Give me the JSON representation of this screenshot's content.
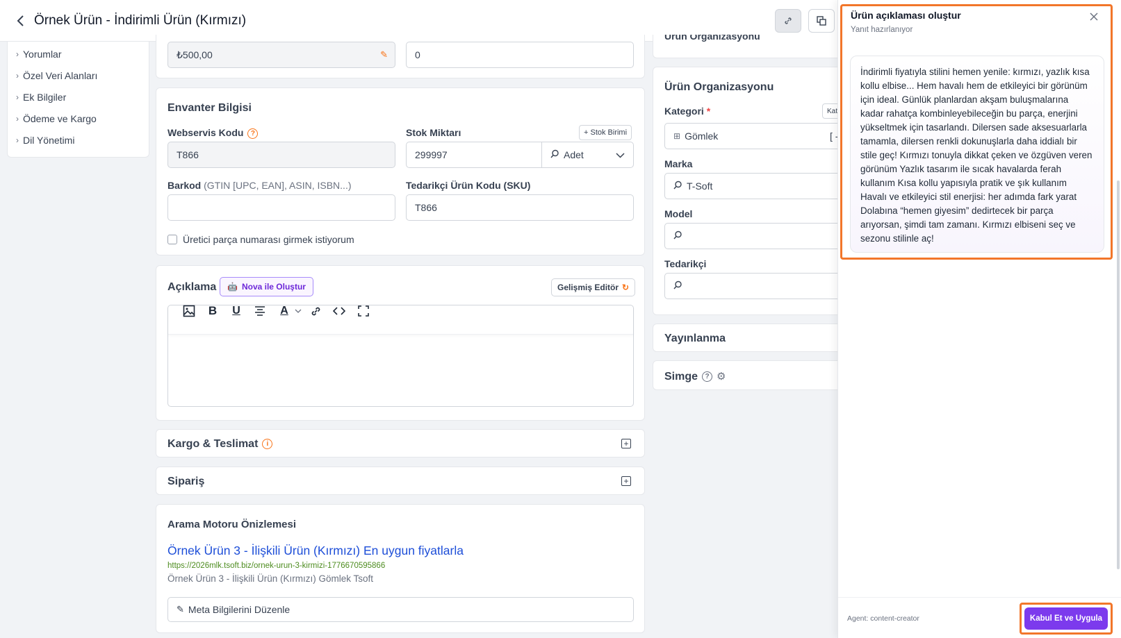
{
  "header": {
    "title": "Örnek Ürün - İndirimli Ürün (Kırmızı)"
  },
  "sidebar": {
    "items": [
      {
        "label": "Yorumlar"
      },
      {
        "label": "Özel Veri Alanları"
      },
      {
        "label": "Ek Bilgiler"
      },
      {
        "label": "Ödeme ve Kargo"
      },
      {
        "label": "Dil Yönetimi"
      }
    ]
  },
  "pricing": {
    "price_value": "₺500,00",
    "second_value": "0"
  },
  "inventory": {
    "title": "Envanter Bilgisi",
    "webservice_label": "Webservis Kodu",
    "webservice_value": "T866",
    "stock_label": "Stok Miktarı",
    "stock_unit_button": "+ Stok Birimi",
    "stock_value": "299997",
    "stock_unit": "Adet",
    "barcode_label": "Barkod",
    "barcode_hint": "(GTIN [UPC, EAN], ASIN, ISBN...)",
    "barcode_value": "",
    "sku_label": "Tedarikçi Ürün Kodu (SKU)",
    "sku_value": "T866",
    "mpn_checkbox": "Üretici parça numarası girmek istiyorum"
  },
  "description": {
    "title": "Açıklama",
    "nova_button": "Nova ile Oluştur",
    "advanced_editor": "Gelişmiş Editör"
  },
  "shipping": {
    "title": "Kargo & Teslimat"
  },
  "order": {
    "title": "Sipariş"
  },
  "seo": {
    "title": "Arama Motoru Önizlemesi",
    "link_title": "Örnek Ürün 3 - İlişkili Ürün (Kırmızı) En uygun fiyatlarla",
    "url": "https://2026mlk.tsoft.biz/ornek-urun-3-kirmizi-1776670595866",
    "description": "Örnek Ürün 3 - İlişkili Ürün (Kırmızı) Gömlek Tsoft",
    "edit_meta": "Meta Bilgilerini Düzenle"
  },
  "organization": {
    "partial_title": "Ürün Organizasyonu",
    "title": "Ürün Organizasyonu",
    "category_label": "Kategori",
    "category_badge": "Kate",
    "category_value": "Gömlek",
    "category_suffix": "[ -",
    "brand_label": "Marka",
    "brand_value": "T-Soft",
    "model_label": "Model",
    "supplier_label": "Tedarikçi"
  },
  "publish": {
    "title": "Yayınlanma"
  },
  "icon_section": {
    "title": "Simge"
  },
  "panel": {
    "title": "Ürün açıklaması oluştur",
    "subtitle": "Yanıt hazırlanıyor",
    "message": "İndirimli fiyatıyla stilini hemen yenile: kırmızı, yazlık kısa kollu elbise... Hem havalı hem de etkileyici bir görünüm için ideal. Günlük planlardan akşam buluşmalarına kadar rahatça kombinleyebileceğin bu parça, enerjini yükseltmek için tasarlandı. Dilersen sade aksesuarlarla tamamla, dilersen renkli dokunuşlarla daha iddialı bir stile geç! Kırmızı tonuyla dikkat çeken ve özgüven veren görünüm Yazlık tasarım ile sıcak havalarda ferah kullanım Kısa kollu yapısıyla pratik ve şık kullanım Havalı ve etkileyici stil enerjisi: her adımda fark yarat Dolabına “hemen giyesim” dedirtecek bir parça arıyorsan, şimdi tam zamanı. Kırmızı elbiseni seç ve sezonu stilinle aç!",
    "agent": "Agent: content-creator",
    "accept_button": "Kabul Et ve Uygula"
  },
  "colors": {
    "accent_orange": "#f2762a",
    "accent_purple": "#7c3aed",
    "link_blue": "#1d4ed8",
    "url_green": "#4d8c1f"
  }
}
